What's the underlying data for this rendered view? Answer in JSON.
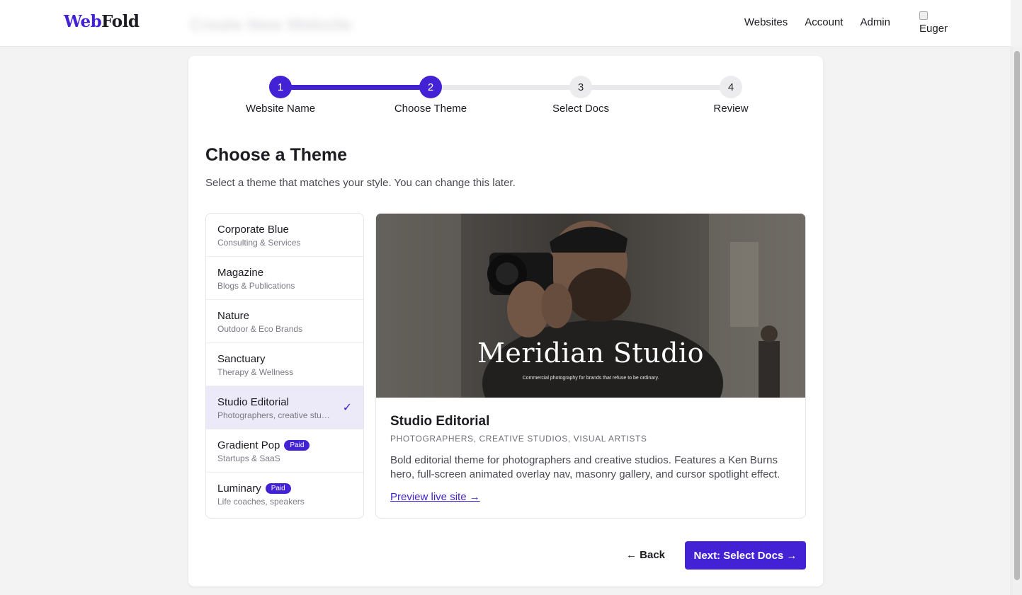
{
  "brand": {
    "logo_part1": "Web",
    "logo_part2": "Fold"
  },
  "header": {
    "blurred_title": "Create New Website",
    "nav": [
      "Websites",
      "Account",
      "Admin"
    ],
    "avatar_alt": "Eugene"
  },
  "stepper": {
    "steps": [
      {
        "number": "1",
        "label": "Website Name",
        "state": "done"
      },
      {
        "number": "2",
        "label": "Choose Theme",
        "state": "current"
      },
      {
        "number": "3",
        "label": "Select Docs",
        "state": "todo"
      },
      {
        "number": "4",
        "label": "Review",
        "state": "todo"
      }
    ]
  },
  "page": {
    "title": "Choose a Theme",
    "subtitle": "Select a theme that matches your style. You can change this later."
  },
  "themes": [
    {
      "name": "Corporate Blue",
      "desc": "Consulting & Services",
      "paid": false,
      "selected": false
    },
    {
      "name": "Magazine",
      "desc": "Blogs & Publications",
      "paid": false,
      "selected": false
    },
    {
      "name": "Nature",
      "desc": "Outdoor & Eco Brands",
      "paid": false,
      "selected": false
    },
    {
      "name": "Sanctuary",
      "desc": "Therapy & Wellness",
      "paid": false,
      "selected": false
    },
    {
      "name": "Studio Editorial",
      "desc": "Photographers, creative studios, visual artists",
      "paid": false,
      "selected": true
    },
    {
      "name": "Gradient Pop",
      "desc": "Startups & SaaS",
      "paid": true,
      "selected": false
    },
    {
      "name": "Luminary",
      "desc": "Life coaches, speakers",
      "paid": true,
      "selected": false
    }
  ],
  "paid_badge": "Paid",
  "preview": {
    "hero_title": "Meridian Studio",
    "hero_tagline": "Commercial photography for brands that refuse to be ordinary.",
    "title": "Studio Editorial",
    "categories": "PHOTOGRAPHERS, CREATIVE STUDIOS, VISUAL ARTISTS",
    "description": "Bold editorial theme for photographers and creative studios. Features a Ken Burns hero, full-screen animated overlay nav, masonry gallery, and cursor spotlight effect.",
    "link": "Preview live site →"
  },
  "footer": {
    "back": "← Back",
    "next": "Next: Select Docs →"
  },
  "colors": {
    "accent": "#4322d6",
    "selected_bg": "#ece9f8"
  }
}
